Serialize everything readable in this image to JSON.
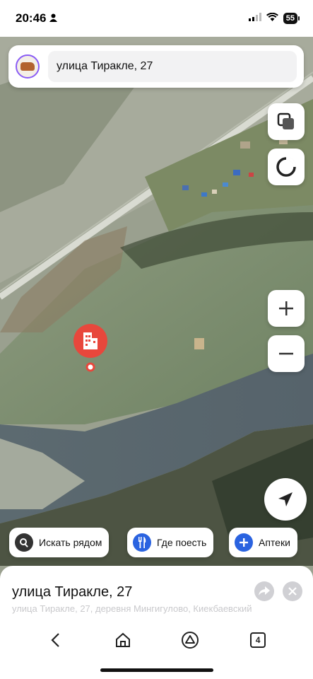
{
  "status": {
    "time": "20:46",
    "battery": "55"
  },
  "search": {
    "value": "улица Тиракле, 27"
  },
  "quick_actions": [
    {
      "label": "Искать рядом",
      "icon": "search-icon",
      "color": "#333333"
    },
    {
      "label": "Где поесть",
      "icon": "fork-knife-icon",
      "color": "#2a63e0"
    },
    {
      "label": "Аптеки",
      "icon": "plus-icon",
      "color": "#2a63e0"
    }
  ],
  "place": {
    "title": "улица Тиракле, 27",
    "subtitle": "улица Тиракле, 27, деревня Мингигулово, Киекбаевский"
  },
  "navbar": {
    "tabs_count": "4"
  },
  "colors": {
    "marker": "#e8473c",
    "accent": "#2a63e0"
  }
}
